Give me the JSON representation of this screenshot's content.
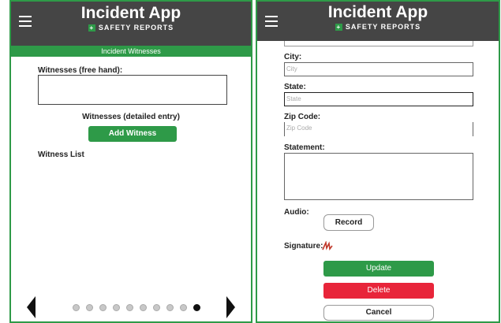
{
  "colors": {
    "header_bg": "#454545",
    "accent_green": "#2e9a48",
    "delete_red": "#e8253a"
  },
  "left": {
    "app_title": "Incident App",
    "app_subtitle": "SAFETY REPORTS",
    "section_title": "Incident Witnesses",
    "witnesses_freehand_label": "Witnesses (free hand):",
    "witnesses_detailed_label": "Witnesses (detailed entry)",
    "add_witness_label": "Add Witness",
    "witness_list_label": "Witness List",
    "page_count": 10,
    "active_page": 10
  },
  "right": {
    "app_title": "Incident App",
    "app_subtitle": "SAFETY REPORTS",
    "city_label": "City:",
    "city_placeholder": "City",
    "state_label": "State:",
    "state_placeholder": "State",
    "zip_label": "Zip Code:",
    "zip_placeholder": "Zip Code",
    "statement_label": "Statement:",
    "audio_label": "Audio:",
    "record_label": "Record",
    "signature_label": "Signature:",
    "update_label": "Update",
    "delete_label": "Delete",
    "cancel_label": "Cancel"
  }
}
